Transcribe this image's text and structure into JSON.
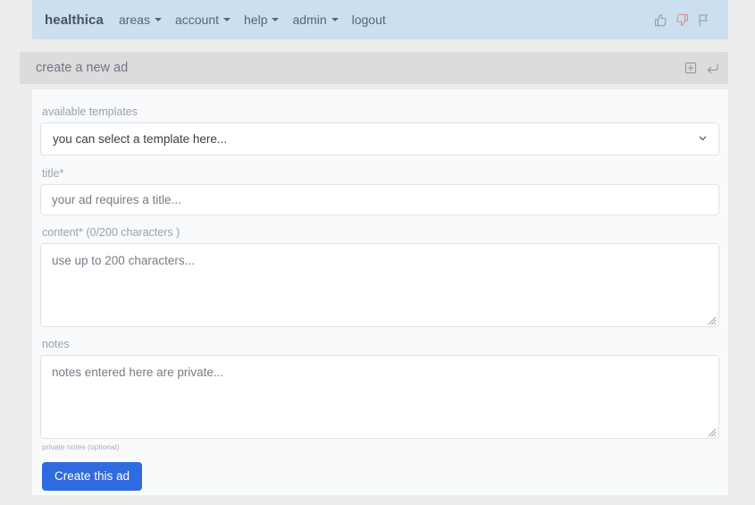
{
  "navbar": {
    "brand": "healthica",
    "items": [
      {
        "label": "areas",
        "has_caret": true
      },
      {
        "label": "account",
        "has_caret": true
      },
      {
        "label": "help",
        "has_caret": true
      },
      {
        "label": "admin",
        "has_caret": true
      },
      {
        "label": "logout",
        "has_caret": false
      }
    ],
    "icons": [
      {
        "name": "thumbs-up-icon",
        "color": "#8a99a8"
      },
      {
        "name": "thumbs-down-icon",
        "color": "#e0848c"
      },
      {
        "name": "flag-icon",
        "color": "#8a99a8"
      }
    ],
    "background": "#cbdff0"
  },
  "page_header": {
    "title": "create a new ad",
    "background": "#dcdcdc",
    "actions": [
      {
        "name": "add-box-icon",
        "label": "add"
      },
      {
        "name": "enter-return-icon",
        "label": "return"
      }
    ]
  },
  "form": {
    "templates": {
      "label": "available templates",
      "selected": "you can select a template here...",
      "options": [
        "you can select a template here..."
      ]
    },
    "title": {
      "label": "title*",
      "value": "",
      "placeholder": "your ad requires a title..."
    },
    "content": {
      "label": "content* (0/200 characters )",
      "value": "",
      "placeholder": "use up to 200 characters...",
      "char_count": 0,
      "char_limit": 200
    },
    "notes": {
      "label": "notes",
      "value": "",
      "placeholder": "notes entered here are private...",
      "help": "private notes (optional)"
    },
    "submit": {
      "label": "Create this ad",
      "color": "#2f6ae0"
    }
  }
}
